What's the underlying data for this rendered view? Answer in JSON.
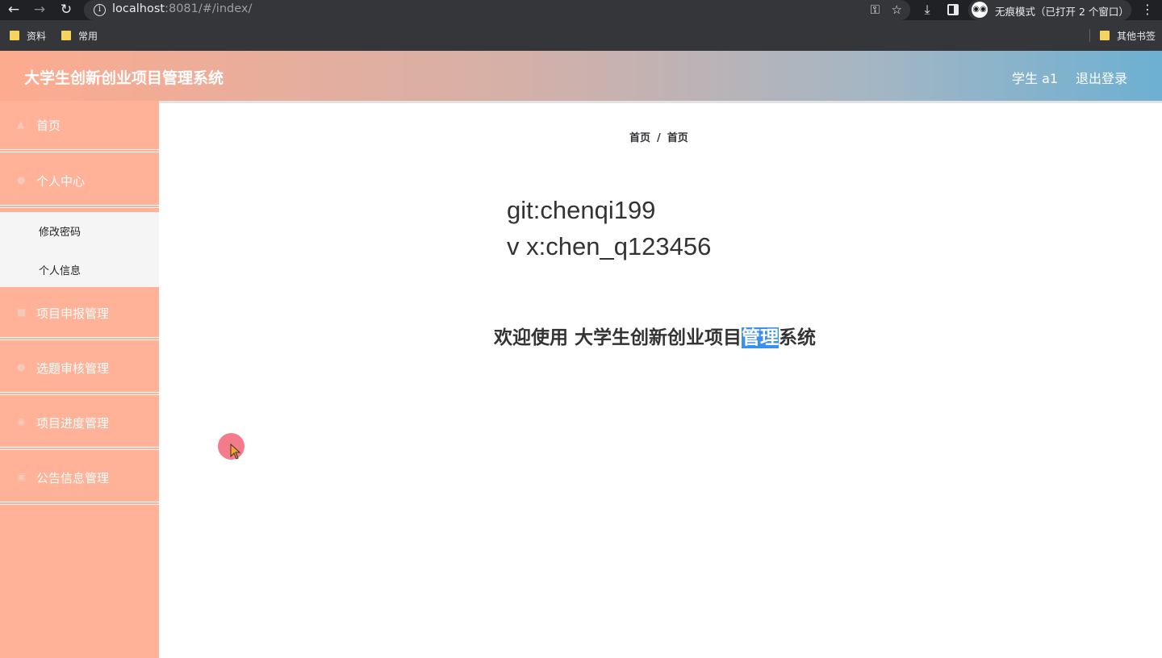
{
  "browser": {
    "url_host": "localhost",
    "url_rest": ":8081/#/index/",
    "incognito_label": "无痕模式（已打开 2 个窗口）",
    "bookmarks": [
      "资料",
      "常用"
    ],
    "other_bookmarks": "其他书签"
  },
  "header": {
    "title": "大学生创新创业项目管理系统",
    "user": "学生 a1",
    "logout": "退出登录"
  },
  "sidebar": {
    "items": [
      {
        "label": "首页",
        "icon": "home-icon"
      },
      {
        "label": "个人中心",
        "icon": "user-icon"
      },
      {
        "label": "项目申报管理",
        "icon": "folder-icon"
      },
      {
        "label": "选题审核管理",
        "icon": "user-icon"
      },
      {
        "label": "项目进度管理",
        "icon": "progress-icon"
      },
      {
        "label": "公告信息管理",
        "icon": "notice-icon"
      }
    ],
    "submenu": [
      "修改密码",
      "个人信息"
    ]
  },
  "main": {
    "breadcrumb": [
      "首页",
      "首页"
    ],
    "contact_line1": "git:chenqi199",
    "contact_line2": "v x:chen_q123456",
    "welcome_prefix": "欢迎使用 大学生创新创业项目",
    "welcome_highlight": "管理",
    "welcome_suffix": "系统"
  }
}
